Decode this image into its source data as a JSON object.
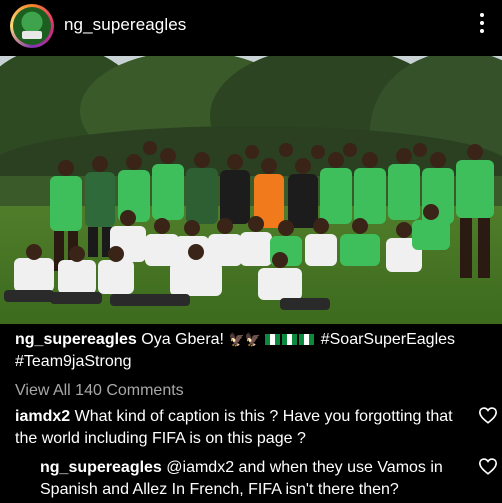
{
  "header": {
    "username": "ng_supereagles",
    "more_icon": "more-vertical-icon"
  },
  "post": {
    "image_alt": "Team photo of the Nigeria national football squad",
    "caption": {
      "username": "ng_supereagles",
      "text_before": "Oya Gbera!",
      "text_after": "#SoarSuperEagles #Team9jaStrong",
      "icons": [
        "eagle-emoji",
        "eagle-emoji",
        "nigeria-flag-emoji",
        "nigeria-flag-emoji",
        "nigeria-flag-emoji"
      ]
    },
    "view_all_comments": "View All 140 Comments"
  },
  "comments": [
    {
      "username": "iamdx2",
      "text": "What kind of caption is this ? Have you forgotting that the world including FIFA is on this page ?"
    },
    {
      "username": "ng_supereagles",
      "text": "@iamdx2 and when they use Vamos in Spanish and Allez In French,  FIFA isn't there then?"
    }
  ],
  "colors": {
    "background": "#000000",
    "text": "#ffffff",
    "muted": "#a8a8a8",
    "kit_green": "#3fbf5c"
  }
}
